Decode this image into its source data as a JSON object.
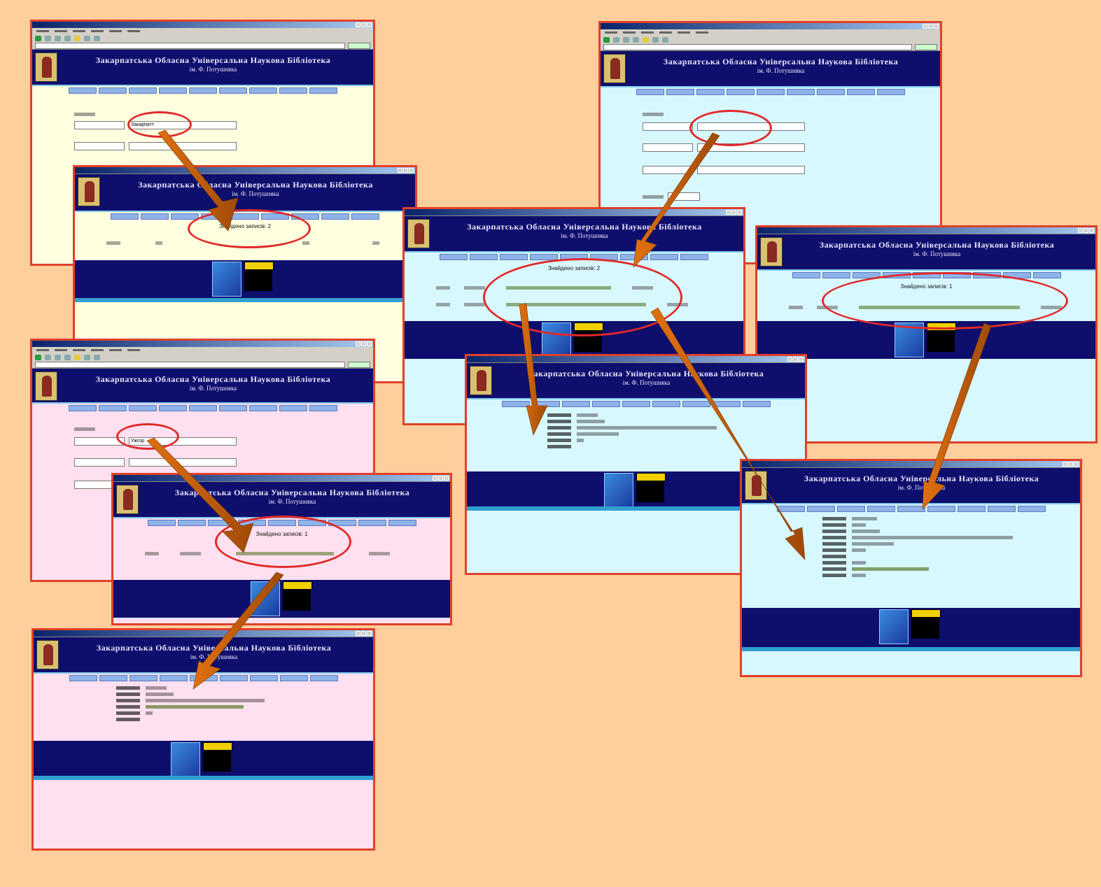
{
  "site": {
    "title": "Закарпатська Обласна Універсальна Наукова Бібліотека",
    "subtitle": "ім. Ф. Потушняка"
  },
  "results": {
    "found_label": "Знайдено записів: 2",
    "found_one": "Знайдено записів: 1"
  },
  "search": {
    "value_1": "Закарпатт",
    "value_2": "Ужгор"
  },
  "colors": {
    "backdrop": "#fecf9c",
    "frame": "#e0402a",
    "header": "#0e0e6c",
    "arrow": "#c8600a",
    "ring": "#e02a2a"
  }
}
